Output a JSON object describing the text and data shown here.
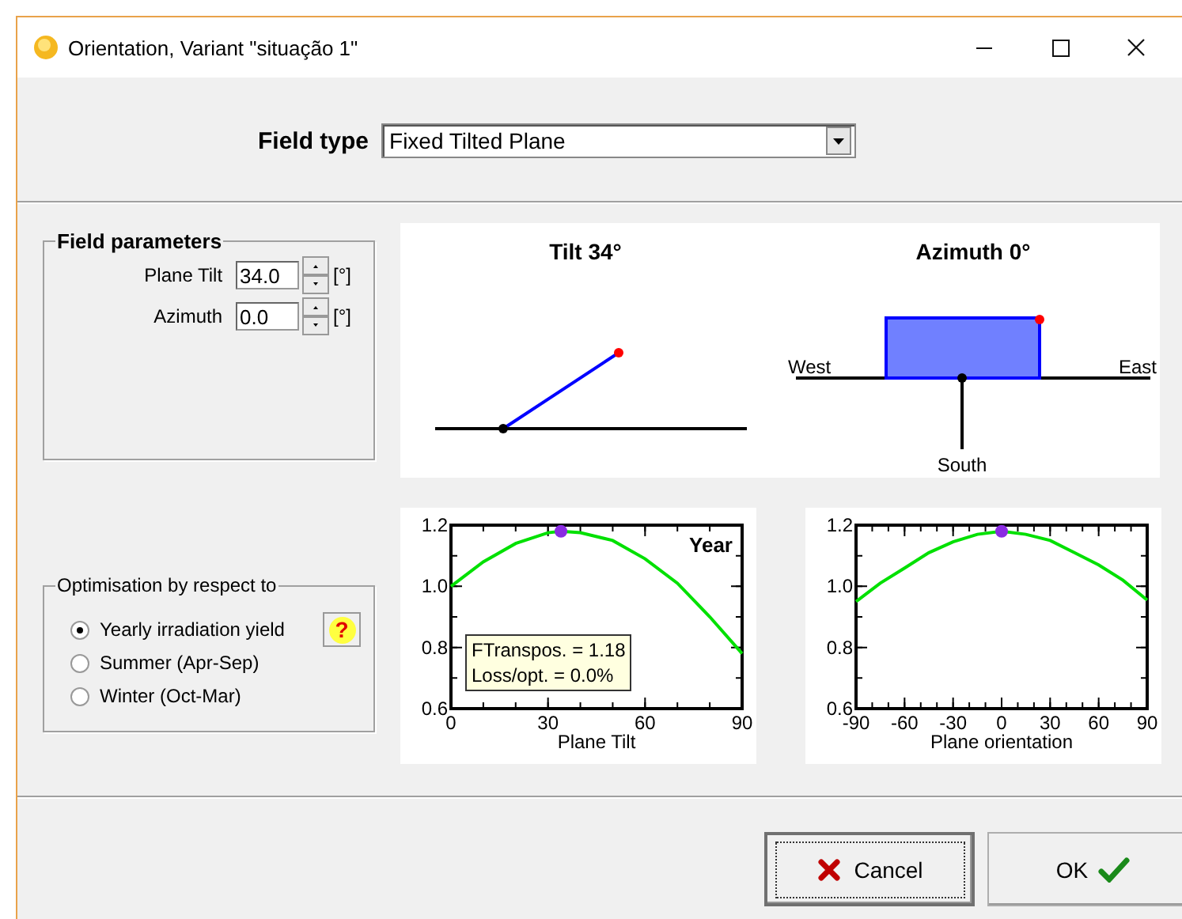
{
  "window": {
    "title": "Orientation, Variant \"situação 1\""
  },
  "field_type": {
    "label": "Field type",
    "value": "Fixed Tilted Plane"
  },
  "field_parameters": {
    "title": "Field parameters",
    "fields": [
      {
        "label": "Plane Tilt",
        "value": "34.0",
        "unit": "[°]"
      },
      {
        "label": "Azimuth",
        "value": "0.0",
        "unit": "[°]"
      }
    ]
  },
  "optimisation": {
    "title": "Optimisation by respect to",
    "options": [
      {
        "label": "Yearly irradiation yield",
        "selected": true
      },
      {
        "label": "Summer (Apr-Sep)",
        "selected": false
      },
      {
        "label": "Winter (Oct-Mar)",
        "selected": false
      }
    ],
    "help": "?"
  },
  "diagram": {
    "tilt_title": "Tilt 34°",
    "azimuth_title": "Azimuth 0°",
    "west": "West",
    "east": "East",
    "south": "South"
  },
  "charts": [
    {
      "info": [
        "FTranspos. = 1.18",
        "Loss/opt. = 0.0%"
      ],
      "chart_data": {
        "type": "line",
        "xlabel": "Plane Tilt",
        "x": [
          0,
          10,
          20,
          30,
          34,
          40,
          50,
          60,
          70,
          80,
          90
        ],
        "series": [
          {
            "name": "Year",
            "color": "#00e000",
            "values": [
              1.0,
              1.08,
              1.14,
              1.175,
              1.18,
              1.175,
              1.15,
              1.09,
              1.01,
              0.9,
              0.78
            ]
          }
        ],
        "xlim": [
          0,
          90
        ],
        "ylim": [
          0.6,
          1.2
        ],
        "xticks": [
          0,
          30,
          60,
          90
        ],
        "yticks": [
          {
            "value": 0.6,
            "label": "0.6"
          },
          {
            "value": 0.8,
            "label": "0.8"
          },
          {
            "value": 1.0,
            "label": "1.0"
          },
          {
            "value": 1.2,
            "label": "1.2"
          }
        ]
      }
    },
    {
      "chart_data": {
        "type": "line",
        "xlabel": "Plane orientation",
        "x": [
          -90,
          -75,
          -60,
          -45,
          -30,
          -15,
          0,
          15,
          30,
          45,
          60,
          75,
          90
        ],
        "series": [
          {
            "color": "#00e000",
            "values": [
              0.95,
              1.01,
              1.06,
              1.11,
              1.145,
              1.17,
              1.18,
              1.17,
              1.15,
              1.11,
              1.07,
              1.02,
              0.955
            ]
          }
        ],
        "xlim": [
          -90,
          90
        ],
        "ylim": [
          0.6,
          1.2
        ],
        "xticks": [
          -90,
          -60,
          -30,
          0,
          30,
          60,
          90
        ],
        "yticks": [
          {
            "value": 0.6,
            "label": "0.6"
          },
          {
            "value": 0.8,
            "label": "0.8"
          },
          {
            "value": 1.0,
            "label": "1.0"
          },
          {
            "value": 1.2,
            "label": "1.2"
          }
        ]
      }
    }
  ],
  "buttons": [
    {
      "kind": "cancel",
      "label": "Cancel"
    },
    {
      "kind": "ok",
      "label": "OK"
    }
  ]
}
